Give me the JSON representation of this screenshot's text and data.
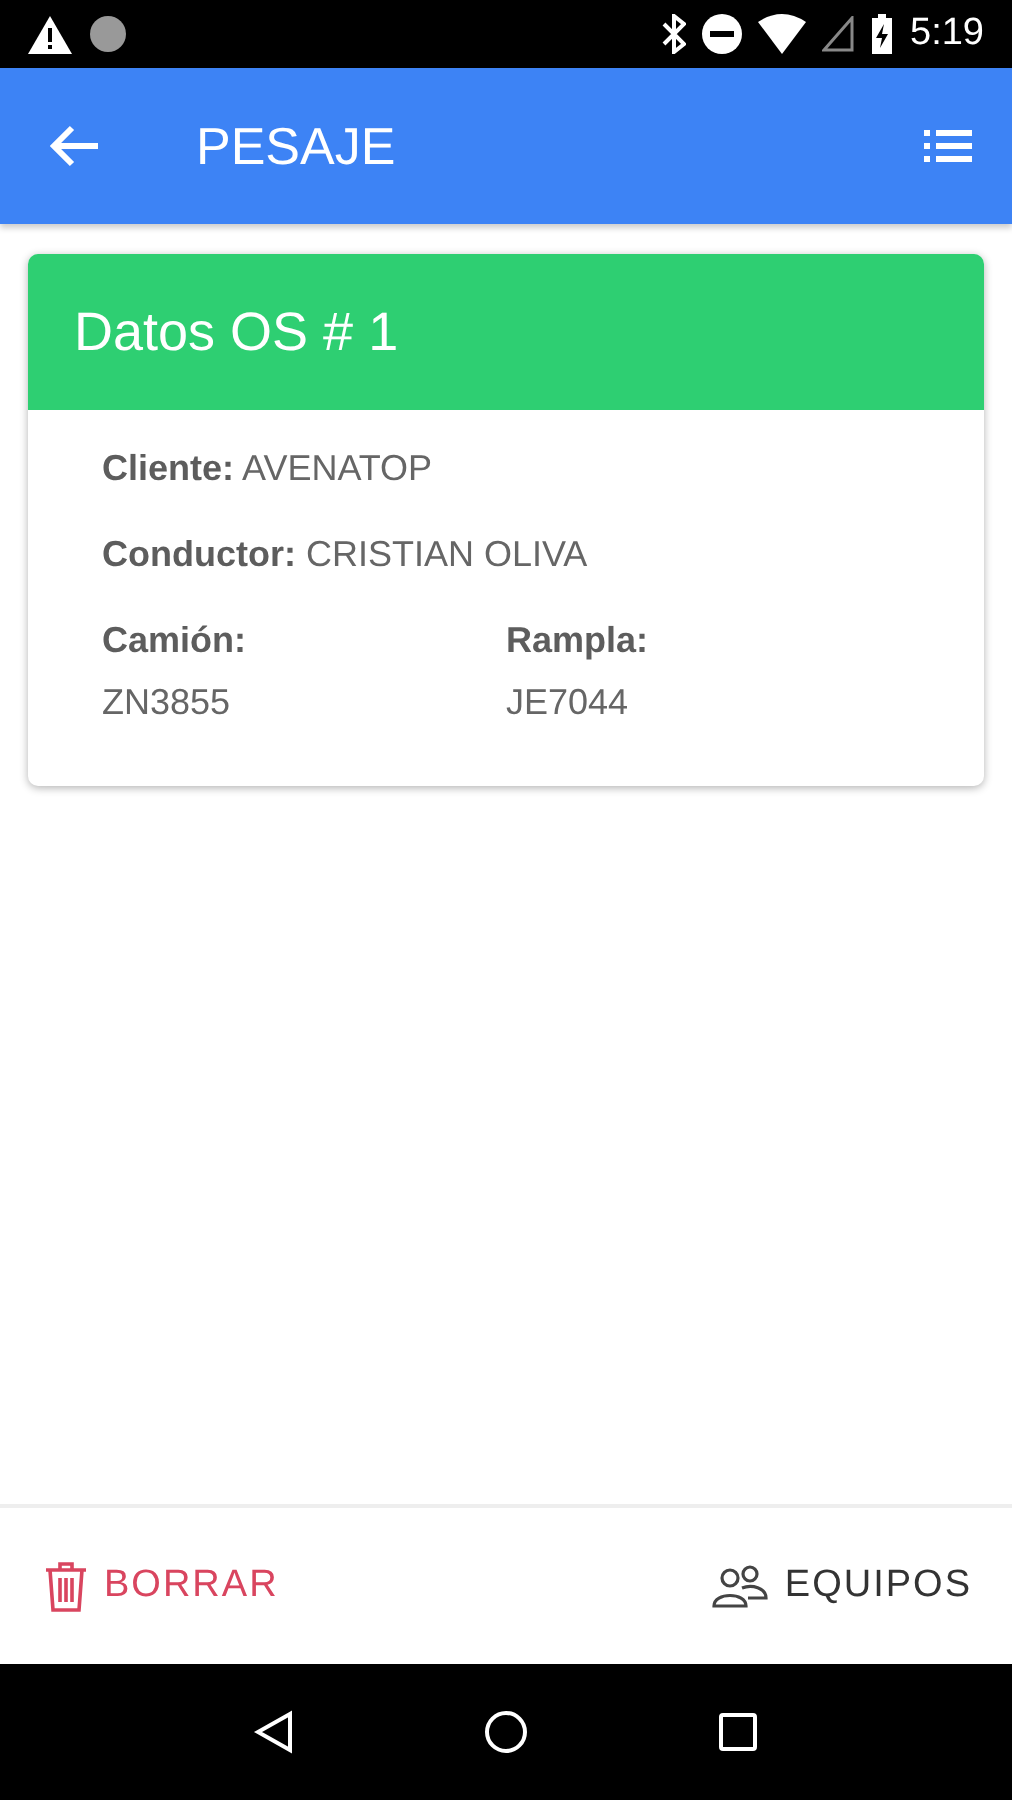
{
  "status_bar": {
    "time": "5:19"
  },
  "app_bar": {
    "title": "PESAJE"
  },
  "card": {
    "title": "Datos OS # 1",
    "fields": [
      {
        "label": "Cliente:",
        "value": "AVENATOP"
      },
      {
        "label": "Conductor:",
        "value": "CRISTIAN OLIVA"
      }
    ],
    "columns": [
      {
        "label": "Camión:",
        "value": "ZN3855"
      },
      {
        "label": "Rampla:",
        "value": "JE7044"
      }
    ]
  },
  "actions": [
    {
      "kind": "delete",
      "label": "BORRAR"
    },
    {
      "kind": "team",
      "label": "EQUIPOS"
    }
  ]
}
